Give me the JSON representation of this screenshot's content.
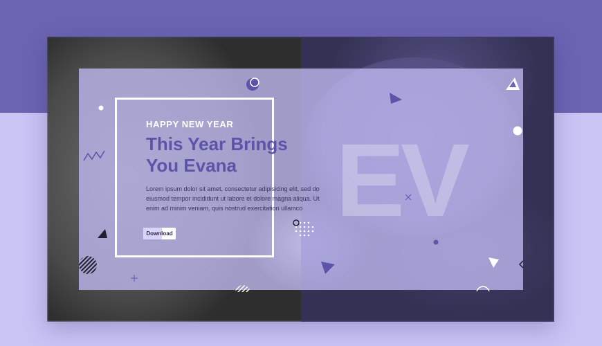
{
  "hero": {
    "kicker": "HAPPY NEW YEAR",
    "headline_line1": "This Year Brings",
    "headline_line2": "You Evana",
    "body": "Lorem ipsum dolor sit amet, consectetur adipisicing elit, sed do eiusmod tempor incididunt ut labore et dolore magna aliqua. Ut enim ad minim veniam, quis nostrud exercitation ullamco",
    "button_label": "Download",
    "watermark": "EV"
  },
  "colors": {
    "accent": "#5b54a8",
    "background_top": "#6b64b2",
    "background_bottom": "#c9c4f4",
    "overlay": "#d6d2f8"
  },
  "decorations": [
    "circle-icon",
    "triangle-icon",
    "zigzag-icon",
    "striped-circle-icon",
    "dot-grid-icon",
    "cross-icon"
  ]
}
